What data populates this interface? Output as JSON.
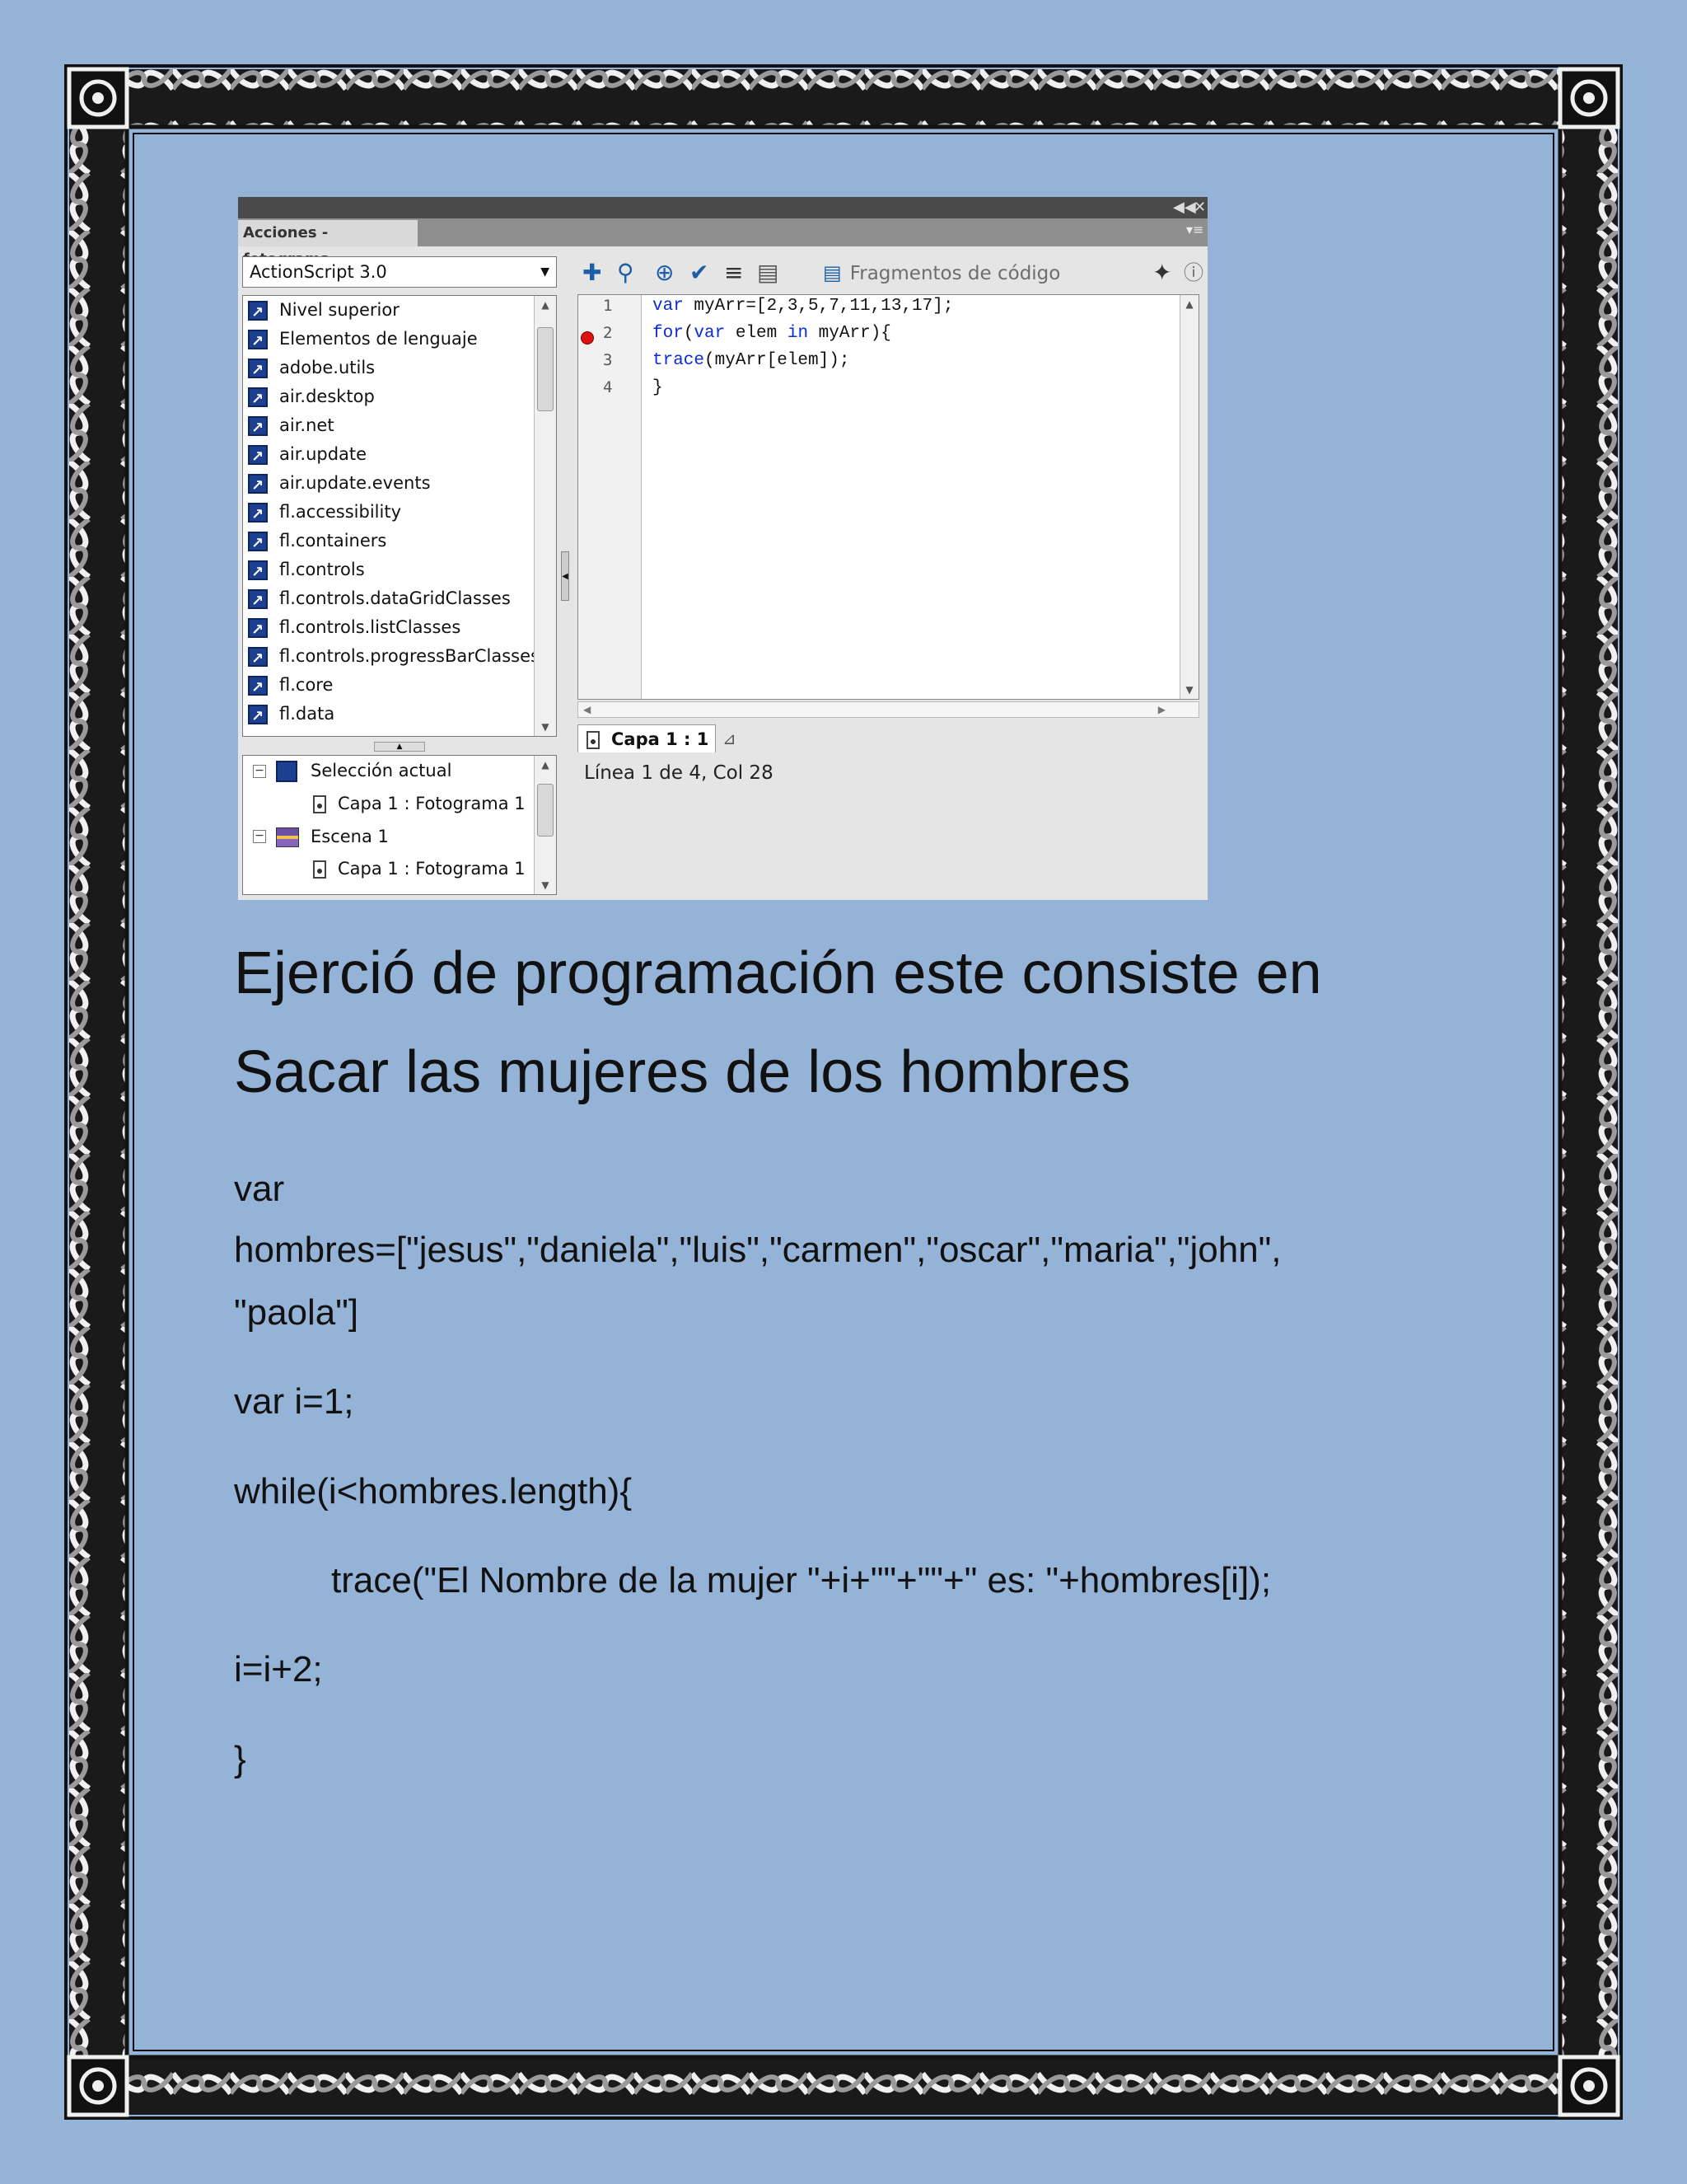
{
  "panel": {
    "title": "Acciones - fotograma",
    "language_select": "ActionScript 3.0",
    "library_items": [
      "Nivel superior",
      "Elementos de lenguaje",
      "adobe.utils",
      "air.desktop",
      "air.net",
      "air.update",
      "air.update.events",
      "fl.accessibility",
      "fl.containers",
      "fl.controls",
      "fl.controls.dataGridClasses",
      "fl.controls.listClasses",
      "fl.controls.progressBarClasses",
      "fl.core",
      "fl.data"
    ],
    "tree": {
      "current_selection": "Selección actual",
      "current_frame": "Capa 1 : Fotograma 1",
      "scene": "Escena 1",
      "scene_frame": "Capa 1 : Fotograma 1"
    },
    "toolbar": {
      "code_fragments": "Fragmentos de código"
    },
    "editor": {
      "line_numbers": [
        "1",
        "2",
        "3",
        "4"
      ],
      "lines": {
        "l1_kw": "var",
        "l1_rest": " myArr=[2,3,5,7,11,13,17];",
        "l2_kw1": "for",
        "l2_mid1": "(",
        "l2_kw2": "var",
        "l2_mid2": " elem ",
        "l2_kw3": "in",
        "l2_rest": " myArr){",
        "l3_kw": "trace",
        "l3_rest": "(myArr[elem]);",
        "l4": "}"
      }
    },
    "layer_tab": "Capa 1 : 1",
    "status": "Línea 1 de 4, Col 28"
  },
  "document": {
    "heading_line1": "Ejerció de programación este consiste en",
    "heading_line2": "Sacar las mujeres de los hombres",
    "code_var": "var",
    "code_array_line1": "hombres=[\"jesus\",\"daniela\",\"luis\",\"carmen\",\"oscar\",\"maria\",\"john\",",
    "code_array_line2": "\"paola\"]",
    "code_init": "var i=1;",
    "code_while": "while(i<hombres.length){",
    "code_trace": "trace(\"El Nombre de la mujer \"+i+\"\"+\"\"+\" es: \"+hombres[i]);",
    "code_increment": "i=i+2;",
    "code_close": "}"
  },
  "colors": {
    "page_background": "#95b3d7",
    "border_dark": "#111111",
    "border_light": "#f2f2f2",
    "keyword_blue": "#0a2bdb"
  }
}
